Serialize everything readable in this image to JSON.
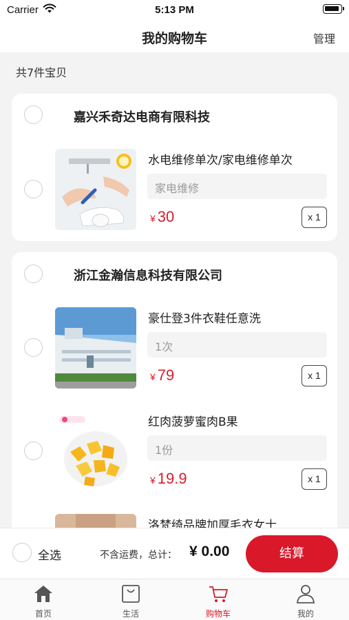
{
  "status_bar": {
    "carrier": "Carrier",
    "time": "5:13 PM"
  },
  "nav": {
    "title": "我的购物车",
    "manage": "管理"
  },
  "summary": {
    "count_text": "共7件宝贝"
  },
  "stores": [
    {
      "name": "嘉兴禾奇达电商有限科技",
      "items": [
        {
          "title": "水电维修单次/家电维修单次",
          "spec": "家电维修",
          "currency": "¥",
          "price": "30",
          "qty": "x 1",
          "image": "electrician-repair-photo"
        }
      ]
    },
    {
      "name": "浙江金瀚信息科技有限公司",
      "items": [
        {
          "title": "豪仕登3件衣鞋任意洗",
          "spec": "1次",
          "currency": "¥",
          "price": "79",
          "qty": "x 1",
          "image": "factory-building-photo"
        },
        {
          "title": "红肉菠萝蜜肉B果",
          "spec": "1份",
          "currency": "¥",
          "price": "19.9",
          "qty": "x 1",
          "image": "jackfruit-bowl-photo"
        },
        {
          "title": "洛梵绮品牌加厚毛衣女士",
          "image": "sweater-photo"
        }
      ]
    }
  ],
  "checkout": {
    "select_all": "全选",
    "freight_note": "不含运费，总计：",
    "total": "¥ 0.00",
    "button": "结算"
  },
  "tabs": [
    {
      "label": "首页",
      "icon": "home-icon",
      "active": false
    },
    {
      "label": "生活",
      "icon": "bag-icon",
      "active": false
    },
    {
      "label": "购物车",
      "icon": "cart-icon",
      "active": true
    },
    {
      "label": "我的",
      "icon": "user-icon",
      "active": false
    }
  ],
  "colors": {
    "accent": "#d9182a",
    "background": "#f3f3f3",
    "card": "#ffffff"
  }
}
